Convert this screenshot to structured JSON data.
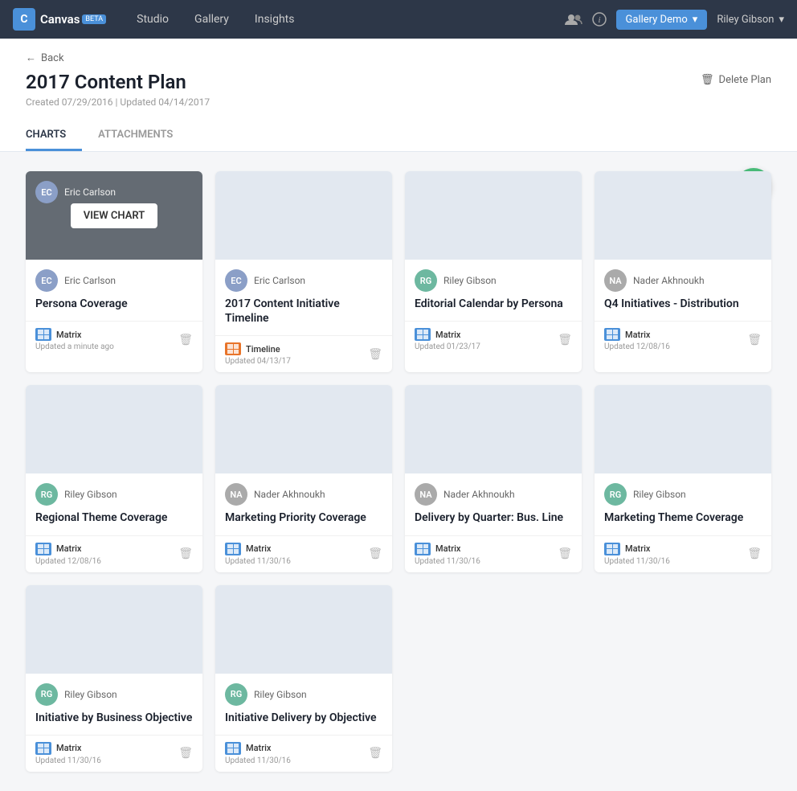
{
  "navbar": {
    "brand": "Canvas",
    "beta": "BETA",
    "nav_links": [
      {
        "label": "Studio",
        "id": "studio"
      },
      {
        "label": "Gallery",
        "id": "gallery"
      },
      {
        "label": "Insights",
        "id": "insights"
      }
    ],
    "gallery_demo": "Gallery Demo",
    "user": "Riley Gibson"
  },
  "page": {
    "back": "Back",
    "title": "2017 Content Plan",
    "created": "Created 07/29/2016  |  Updated 04/14/2017",
    "delete": "Delete Plan"
  },
  "tabs": [
    {
      "label": "CHARTS",
      "id": "charts",
      "active": true
    },
    {
      "label": "ATTACHMENTS",
      "id": "attachments",
      "active": false
    }
  ],
  "add_btn": "+",
  "cards": [
    {
      "id": "card-1",
      "author": "Eric Carlson",
      "title": "Persona Coverage",
      "type": "Matrix",
      "type_style": "blue",
      "updated": "Updated a minute ago",
      "hovered": true,
      "view_chart_label": "VIEW CHART"
    },
    {
      "id": "card-2",
      "author": "Eric Carlson",
      "title": "2017 Content Initiative Timeline",
      "type": "Timeline",
      "type_style": "orange",
      "updated": "Updated 04/13/17",
      "hovered": false
    },
    {
      "id": "card-3",
      "author": "Riley Gibson",
      "title": "Editorial Calendar by Persona",
      "type": "Matrix",
      "type_style": "blue",
      "updated": "Updated 01/23/17",
      "hovered": false
    },
    {
      "id": "card-4",
      "author": "Nader Akhnoukh",
      "title": "Q4 Initiatives - Distribution",
      "type": "Matrix",
      "type_style": "blue",
      "updated": "Updated 12/08/16",
      "hovered": false
    },
    {
      "id": "card-5",
      "author": "Riley Gibson",
      "title": "Regional Theme Coverage",
      "type": "Matrix",
      "type_style": "blue",
      "updated": "Updated 12/08/16",
      "hovered": false
    },
    {
      "id": "card-6",
      "author": "Nader Akhnoukh",
      "title": "Marketing Priority Coverage",
      "type": "Matrix",
      "type_style": "blue",
      "updated": "Updated 11/30/16",
      "hovered": false
    },
    {
      "id": "card-7",
      "author": "Nader Akhnoukh",
      "title": "Delivery by Quarter: Bus. Line",
      "type": "Matrix",
      "type_style": "blue",
      "updated": "Updated 11/30/16",
      "hovered": false
    },
    {
      "id": "card-8",
      "author": "Riley Gibson",
      "title": "Marketing Theme Coverage",
      "type": "Matrix",
      "type_style": "blue",
      "updated": "Updated 11/30/16",
      "hovered": false
    },
    {
      "id": "card-9",
      "author": "Riley Gibson",
      "title": "Initiative by Business Objective",
      "type": "Matrix",
      "type_style": "blue",
      "updated": "Updated 11/30/16",
      "hovered": false
    },
    {
      "id": "card-10",
      "author": "Riley Gibson",
      "title": "Initiative Delivery by Objective",
      "type": "Matrix",
      "type_style": "blue",
      "updated": "Updated 11/30/16",
      "hovered": false
    }
  ],
  "author_initials": {
    "Eric Carlson": "EC",
    "Riley Gibson": "RG",
    "Nader Akhnoukh": "NA"
  },
  "author_colors": {
    "Eric Carlson": "#8b9fc7",
    "Riley Gibson": "#6db8a0",
    "Nader Akhnoukh": "#aaa"
  }
}
